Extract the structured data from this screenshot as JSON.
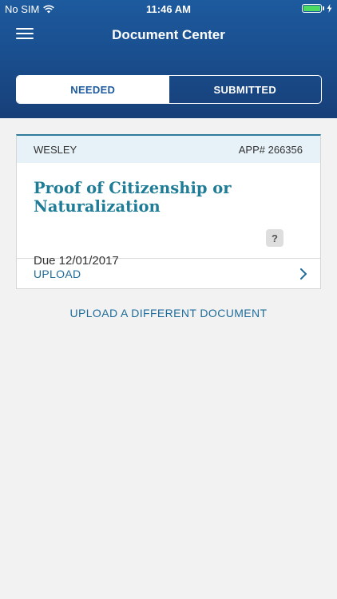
{
  "status_bar": {
    "carrier": "No SIM",
    "time": "11:46 AM"
  },
  "nav": {
    "title": "Document Center"
  },
  "tabs": [
    {
      "label": "NEEDED",
      "active": true
    },
    {
      "label": "SUBMITTED",
      "active": false
    }
  ],
  "card": {
    "name": "WESLEY",
    "app_number": "APP# 266356",
    "title_line1": "Proof of Citizenship or",
    "title_line2": "Naturalization",
    "help_symbol": "?",
    "due": "Due 12/01/2017",
    "upload_label": "UPLOAD"
  },
  "alt_link": "UPLOAD A DIFFERENT DOCUMENT",
  "colors": {
    "header_blue": "#1a4f8f",
    "accent_teal": "#1f7c96",
    "link_blue": "#1f6c9a",
    "battery_green": "#4cd964"
  },
  "icons": [
    "wifi-icon",
    "battery-icon",
    "bolt-icon",
    "menu-icon",
    "help-icon",
    "chevron-right-icon"
  ]
}
